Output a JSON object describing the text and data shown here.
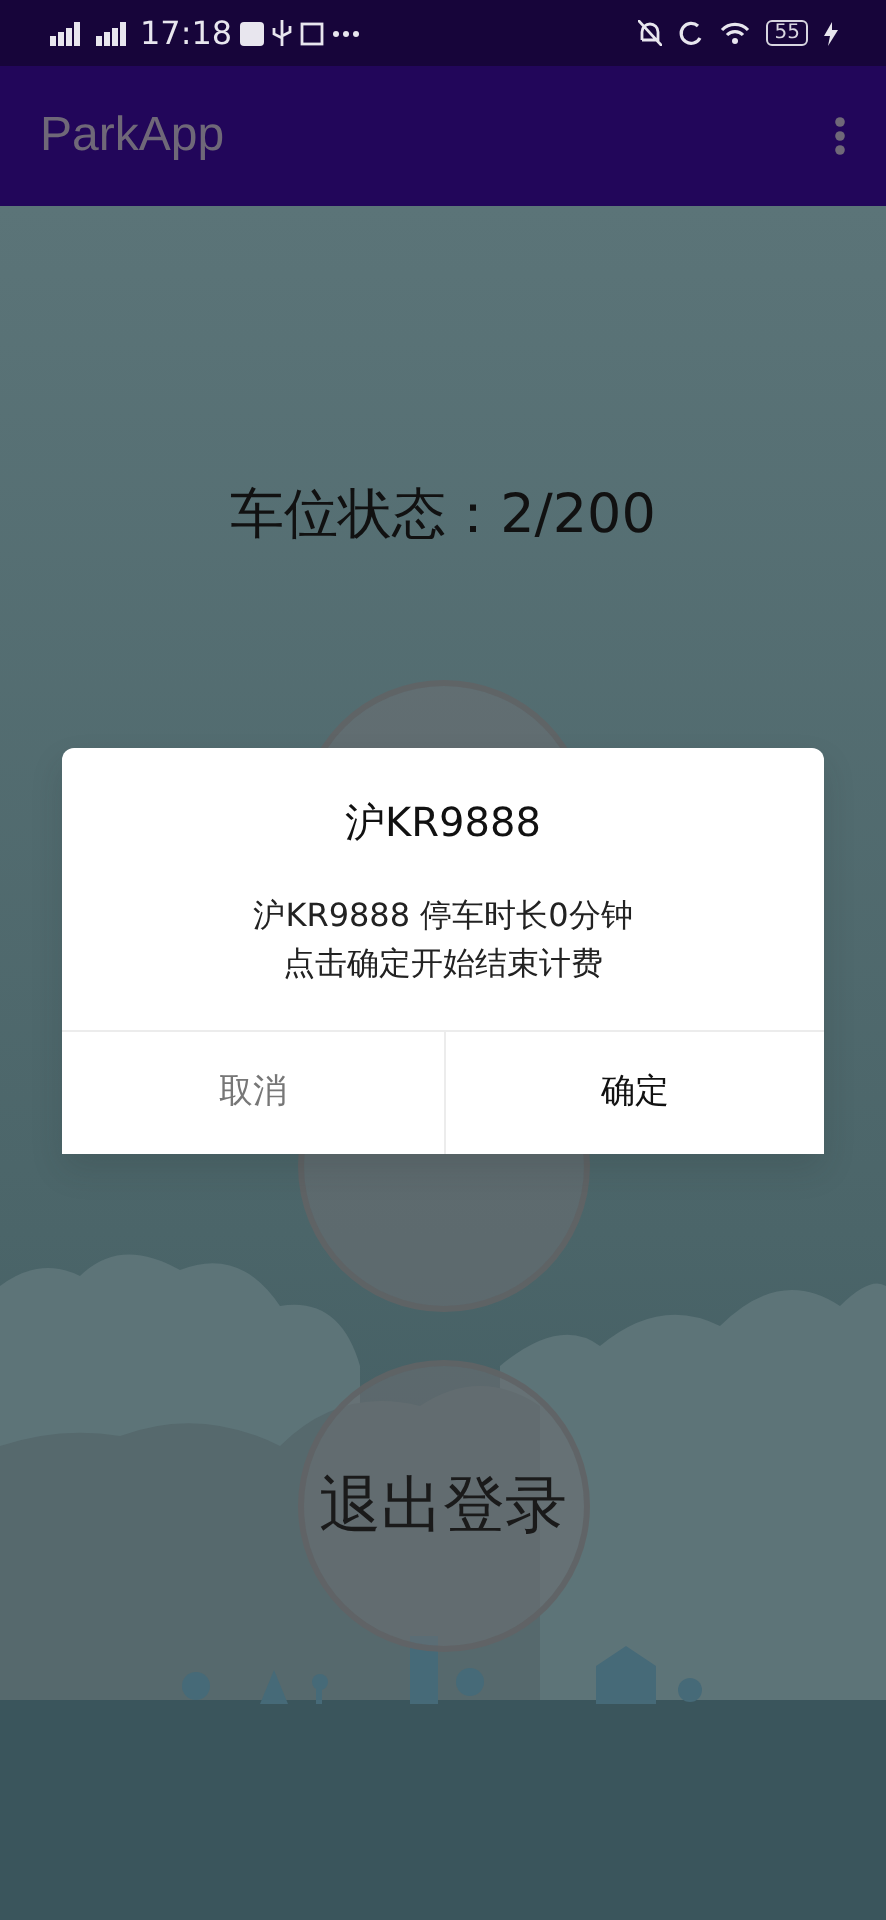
{
  "status_bar": {
    "time": "17:18",
    "battery": "55"
  },
  "app_bar": {
    "title": "ParkApp"
  },
  "main": {
    "parking_status": "车位状态：2/200",
    "buttons": [
      {
        "kind": "covered"
      },
      {
        "kind": "covered"
      },
      {
        "kind": "labeled",
        "label": "退出登录"
      }
    ]
  },
  "dialog": {
    "title": "沪KR9888",
    "message_lines": [
      "沪KR9888 停车时长0分钟",
      "点击确定开始结束计费"
    ],
    "buttons": [
      {
        "kind": "cancel",
        "label": "取消"
      },
      {
        "kind": "confirm",
        "label": "确定"
      }
    ]
  }
}
